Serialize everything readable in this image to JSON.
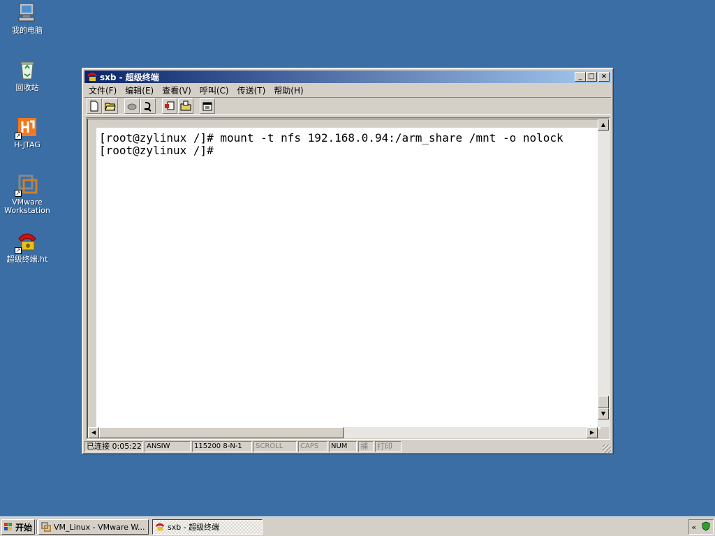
{
  "desktop": {
    "icons": [
      {
        "label": "我的电脑",
        "icon": "my-computer-icon"
      },
      {
        "label": "回收站",
        "icon": "recycle-bin-icon"
      },
      {
        "label": "H-JTAG",
        "icon": "hjtag-icon"
      },
      {
        "label": "VMware\nWorkstation",
        "icon": "vmware-icon"
      },
      {
        "label": "超级终端.ht",
        "icon": "hyperterminal-icon"
      }
    ]
  },
  "window": {
    "title": "sxb - 超级终端",
    "buttons": {
      "minimize": "_",
      "maximize": "□",
      "close": "×"
    },
    "menu": [
      "文件(F)",
      "编辑(E)",
      "查看(V)",
      "呼叫(C)",
      "传送(T)",
      "帮助(H)"
    ],
    "toolbar": [
      "new-icon",
      "open-icon",
      "disconnect-icon",
      "call-icon",
      "send-icon",
      "receive-icon",
      "properties-icon"
    ],
    "terminal_lines": [
      "[root@zylinux /]# mount -t nfs 192.168.0.94:/arm_share /mnt -o nolock",
      "[root@zylinux /]#"
    ],
    "status": {
      "connected": "已连接 0:05:22",
      "emulation": "ANSIW",
      "settings": "115200 8-N-1",
      "scroll": "SCROLL",
      "caps": "CAPS",
      "num": "NUM",
      "capture": "捕",
      "print": "打印"
    }
  },
  "taskbar": {
    "start_label": "开始",
    "tasks": [
      {
        "label": "VM_Linux - VMware W..."
      },
      {
        "label": "sxb - 超级终端"
      }
    ],
    "tray_expand": "«"
  },
  "colors": {
    "desktop": "#3a6ea5",
    "title_start": "#0a246a",
    "title_end": "#a6caf0",
    "face": "#d4d0c8"
  }
}
